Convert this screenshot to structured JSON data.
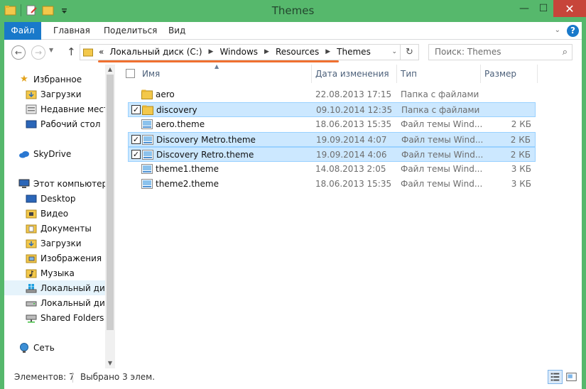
{
  "window": {
    "title": "Themes"
  },
  "title_controls": {
    "minimize": "—",
    "maximize": "☐",
    "close": "✕"
  },
  "ribbon": {
    "tabs": [
      "Файл",
      "Главная",
      "Поделиться",
      "Вид"
    ],
    "help": "?"
  },
  "navigation": {
    "breadcrumb_overflow": "«",
    "breadcrumb": [
      "Локальный диск (C:)",
      "Windows",
      "Resources",
      "Themes"
    ],
    "search_placeholder": "Поиск: Themes"
  },
  "nav_pane": {
    "items": [
      {
        "label": "Избранное",
        "icon": "star-icon"
      },
      {
        "label": "Загрузки",
        "icon": "downloads-folder-icon"
      },
      {
        "label": "Недавние места",
        "icon": "recent-places-icon"
      },
      {
        "label": "Рабочий стол",
        "icon": "desktop-icon"
      },
      {
        "label": "SkyDrive",
        "icon": "skydrive-cloud-icon"
      },
      {
        "label": "Этот компьютер",
        "icon": "computer-icon"
      },
      {
        "label": "Desktop",
        "icon": "desktop-folder-icon"
      },
      {
        "label": "Видео",
        "icon": "videos-folder-icon"
      },
      {
        "label": "Документы",
        "icon": "documents-folder-icon"
      },
      {
        "label": "Загрузки",
        "icon": "downloads-folder-icon"
      },
      {
        "label": "Изображения",
        "icon": "pictures-folder-icon"
      },
      {
        "label": "Музыка",
        "icon": "music-folder-icon"
      },
      {
        "label": "Локальный диск",
        "icon": "windows-drive-icon",
        "selected": true
      },
      {
        "label": "Локальный диск",
        "icon": "drive-icon"
      },
      {
        "label": "Shared Folders (\\",
        "icon": "network-drive-icon"
      },
      {
        "label": "Сеть",
        "icon": "network-icon"
      }
    ]
  },
  "file_list": {
    "columns": {
      "name": "Имя",
      "date": "Дата изменения",
      "type": "Тип",
      "size": "Размер"
    },
    "rows": [
      {
        "name": "aero",
        "date": "22.08.2013 17:15",
        "type": "Папка с файлами",
        "size": "",
        "icon": "folder-icon",
        "checked": false,
        "selected": false
      },
      {
        "name": "discovery",
        "date": "09.10.2014 12:35",
        "type": "Папка с файлами",
        "size": "",
        "icon": "folder-icon",
        "checked": true,
        "selected": true
      },
      {
        "name": "aero.theme",
        "date": "18.06.2013 15:35",
        "type": "Файл темы Wind...",
        "size": "2 КБ",
        "icon": "theme-file-icon",
        "checked": false,
        "selected": false
      },
      {
        "name": "Discovery Metro.theme",
        "date": "19.09.2014 4:07",
        "type": "Файл темы Wind...",
        "size": "2 КБ",
        "icon": "theme-file-icon",
        "checked": true,
        "selected": true
      },
      {
        "name": "Discovery Retro.theme",
        "date": "19.09.2014 4:06",
        "type": "Файл темы Wind...",
        "size": "2 КБ",
        "icon": "theme-file-icon",
        "checked": true,
        "selected": true
      },
      {
        "name": "theme1.theme",
        "date": "14.08.2013 2:05",
        "type": "Файл темы Wind...",
        "size": "3 КБ",
        "icon": "theme-file-icon",
        "checked": false,
        "selected": false
      },
      {
        "name": "theme2.theme",
        "date": "18.06.2013 15:35",
        "type": "Файл темы Wind...",
        "size": "3 КБ",
        "icon": "theme-file-icon",
        "checked": false,
        "selected": false
      }
    ]
  },
  "status_bar": {
    "item_count": "Элементов: 7",
    "selected_count": "Выбрано 3 элем."
  },
  "colors": {
    "title_bar": "#56b86c",
    "file_tab": "#1979ca",
    "selection": "#cce8ff",
    "close_button": "#c7453a",
    "address_underline": "#f07030"
  }
}
